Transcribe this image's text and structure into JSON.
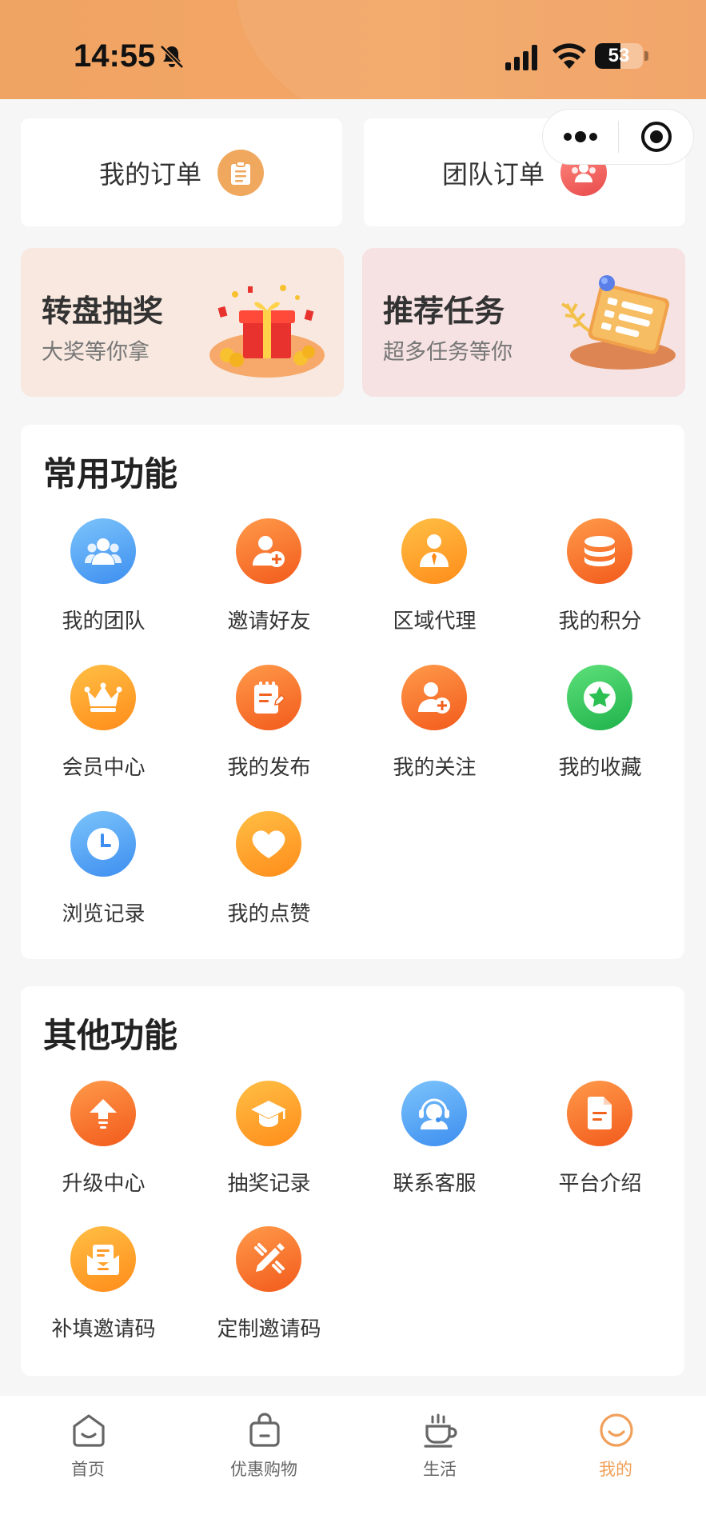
{
  "status_bar": {
    "time": "14:55",
    "battery": "53",
    "battery_level": 0.53
  },
  "orders": {
    "my_orders": "我的订单",
    "team_orders": "团队订单"
  },
  "promos": {
    "lottery": {
      "title": "转盘抽奖",
      "subtitle": "大奖等你拿"
    },
    "tasks": {
      "title": "推荐任务",
      "subtitle": "超多任务等你"
    }
  },
  "common": {
    "title": "常用功能",
    "items": [
      {
        "label": "我的团队",
        "icon": "team-icon",
        "color": "blue"
      },
      {
        "label": "邀请好友",
        "icon": "invite-friend-icon",
        "color": "orange"
      },
      {
        "label": "区域代理",
        "icon": "agent-icon",
        "color": "amber"
      },
      {
        "label": "我的积分",
        "icon": "points-icon",
        "color": "orange"
      },
      {
        "label": "会员中心",
        "icon": "crown-icon",
        "color": "amber"
      },
      {
        "label": "我的发布",
        "icon": "publish-icon",
        "color": "orange"
      },
      {
        "label": "我的关注",
        "icon": "follow-icon",
        "color": "orange"
      },
      {
        "label": "我的收藏",
        "icon": "star-icon",
        "color": "green"
      },
      {
        "label": "浏览记录",
        "icon": "clock-icon",
        "color": "blue"
      },
      {
        "label": "我的点赞",
        "icon": "heart-icon",
        "color": "amber"
      }
    ]
  },
  "other": {
    "title": "其他功能",
    "items": [
      {
        "label": "升级中心",
        "icon": "upgrade-icon",
        "color": "orange"
      },
      {
        "label": "抽奖记录",
        "icon": "graduation-cap-icon",
        "color": "amber"
      },
      {
        "label": "联系客服",
        "icon": "customer-service-icon",
        "color": "blue"
      },
      {
        "label": "平台介绍",
        "icon": "document-icon",
        "color": "orange"
      },
      {
        "label": "补填邀请码",
        "icon": "mail-icon",
        "color": "amber"
      },
      {
        "label": "定制邀请码",
        "icon": "edit-icon",
        "color": "orange"
      }
    ]
  },
  "tabbar": {
    "tabs": [
      {
        "label": "首页",
        "icon": "home-icon"
      },
      {
        "label": "优惠购物",
        "icon": "shopping-bag-icon"
      },
      {
        "label": "生活",
        "icon": "coffee-cup-icon"
      },
      {
        "label": "我的",
        "icon": "smile-icon"
      }
    ],
    "active": "我的",
    "active_color": "#f0a05a"
  }
}
